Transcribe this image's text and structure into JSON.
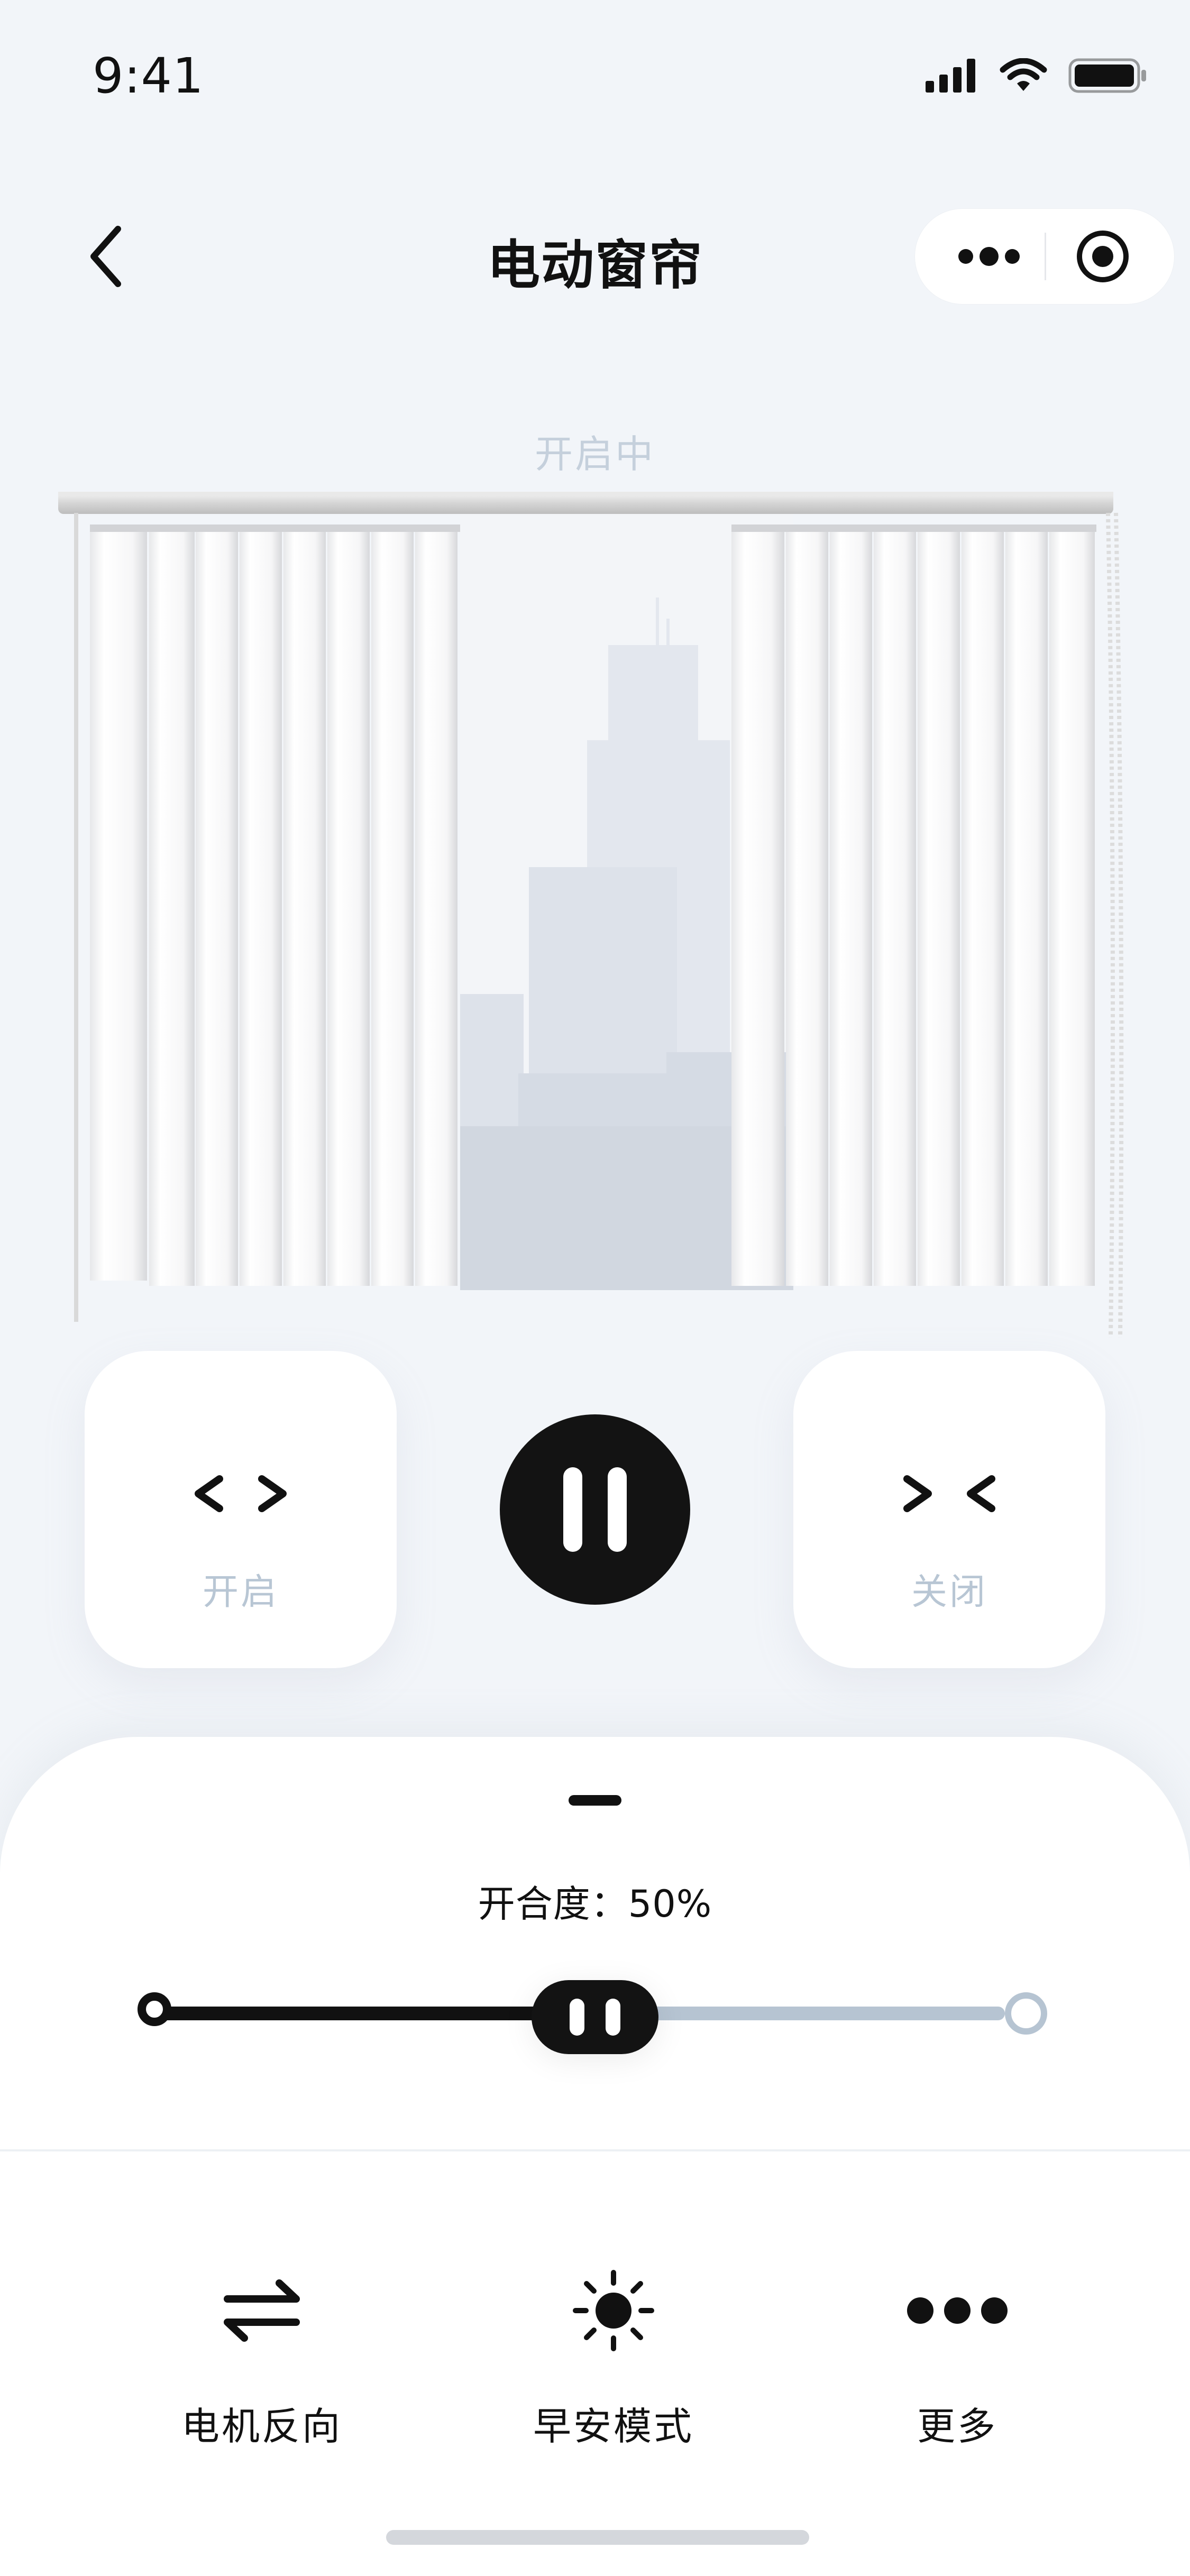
{
  "status_bar": {
    "time": "9:41"
  },
  "nav": {
    "title": "电动窗帘"
  },
  "curtain": {
    "status_text": "开启中"
  },
  "controls": {
    "open_label": "开启",
    "close_label": "关闭",
    "open_glyph": "< >",
    "close_glyph": "> <"
  },
  "sheet": {
    "degree_text": "开合度：50%",
    "degree_value": 50
  },
  "actions": [
    {
      "label": "电机反向",
      "icon": "swap-arrows-icon"
    },
    {
      "label": "早安模式",
      "icon": "sun-icon"
    },
    {
      "label": "更多",
      "icon": "more-dots-icon"
    }
  ],
  "colors": {
    "background": "#f2f5f9",
    "dark": "#131313",
    "muted_label": "#b8c6d4",
    "track_light": "#b6c4d2"
  }
}
